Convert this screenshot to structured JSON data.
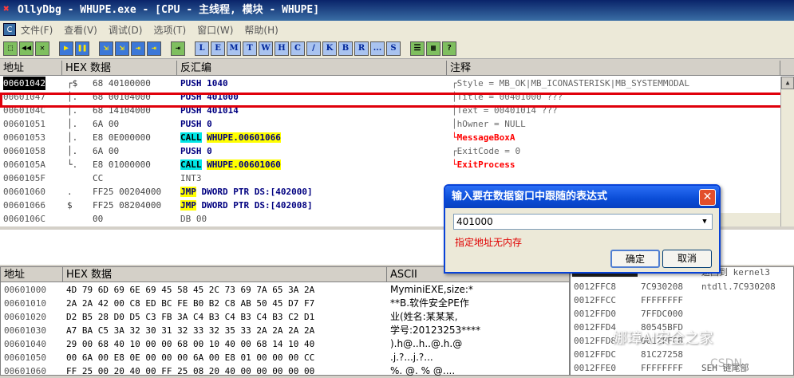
{
  "window": {
    "title": "OllyDbg - WHUPE.exe - [CPU - 主线程, 模块 - WHUPE]"
  },
  "menu": [
    "文件(F)",
    "查看(V)",
    "调试(D)",
    "选项(T)",
    "窗口(W)",
    "帮助(H)"
  ],
  "toolbar": {
    "buttons_left": [
      "⬚",
      "◀◀",
      "✕",
      "▶",
      "❚❚",
      "⇲",
      "⇲",
      "⇥",
      "⇥",
      "⇥"
    ],
    "letter_buttons": [
      "L",
      "E",
      "M",
      "T",
      "W",
      "H",
      "C",
      "/",
      "K",
      "B",
      "R",
      "...",
      "S"
    ],
    "buttons_right": [
      "☰",
      "▦",
      "?"
    ]
  },
  "cpu": {
    "headers": [
      "地址",
      "HEX 数据",
      "反汇编",
      "注释"
    ],
    "rows": [
      {
        "addr": "00601042",
        "brk": "┌$",
        "hex": "68 40100000",
        "dis": "PUSH 1040",
        "cmt": "┌Style = MB_OK|MB_ICONASTERISK|MB_SYSTEMMODAL"
      },
      {
        "addr": "00601047",
        "brk": "│.",
        "hex": "68 00104000",
        "dis": "PUSH 401000",
        "cmt": "│Title = 00401000 ???"
      },
      {
        "addr": "0060104C",
        "brk": "│.",
        "hex": "68 14104000",
        "dis": "PUSH 401014",
        "cmt": "│Text = 00401014 ???"
      },
      {
        "addr": "00601051",
        "brk": "│.",
        "hex": "6A 00",
        "dis": "PUSH 0",
        "cmt": "│hOwner = NULL"
      },
      {
        "addr": "00601053",
        "brk": "│.",
        "hex": "E8 0E000000",
        "dis_op": "CALL",
        "dis_arg": "WHUPE.00601066",
        "cmt": "└MessageBoxA"
      },
      {
        "addr": "00601058",
        "brk": "│.",
        "hex": "6A 00",
        "dis": "PUSH 0",
        "cmt": "┌ExitCode = 0"
      },
      {
        "addr": "0060105A",
        "brk": "└.",
        "hex": "E8 01000000",
        "dis_op": "CALL",
        "dis_arg": "WHUPE.00601060",
        "cmt": "└ExitProcess"
      },
      {
        "addr": "0060105F",
        "brk": "",
        "hex": "CC",
        "dis": "INT3",
        "cmt": ""
      },
      {
        "addr": "00601060",
        "brk": ".",
        "hex": "FF25 00204000",
        "dis_op": "JMP",
        "dis_arg": "DWORD PTR DS:[402000]",
        "cmt": ""
      },
      {
        "addr": "00601066",
        "brk": "$",
        "hex": "FF25 08204000",
        "dis_op": "JMP",
        "dis_arg": "DWORD PTR DS:[402008]",
        "cmt": ""
      },
      {
        "addr": "0060106C",
        "brk": "",
        "hex": "00",
        "dis": "DB 00",
        "cmt": ""
      }
    ]
  },
  "dump": {
    "headers": [
      "地址",
      "HEX 数据",
      "ASCII"
    ],
    "rows": [
      {
        "addr": "00601000",
        "hex": "4D 79 6D 69 6E 69 45 58 45 2C 73 69 7A 65 3A 2A",
        "ascii": "MyminiEXE,size:*"
      },
      {
        "addr": "00601010",
        "hex": "2A 2A 42 00 C8 ED BC FE B0 B2 C8 AB 50 45 D7 F7",
        "ascii": "**B.软件安全PE作"
      },
      {
        "addr": "00601020",
        "hex": "D2 B5 28 D0 D5 C3 FB 3A C4 B3 C4 B3 C4 B3 C2 D1",
        "ascii": "业(姓名:某某某,"
      },
      {
        "addr": "00601030",
        "hex": "A7 BA C5 3A 32 30 31 32 33 32 35 33 2A 2A 2A 2A",
        "ascii": "学号:20123253****"
      },
      {
        "addr": "00601040",
        "hex": "29 00 68 40 10 00 00 68 00 10 40 00 68 14 10 40",
        "ascii": ").h@..h..@.h.@"
      },
      {
        "addr": "00601050",
        "hex": "00 6A 00 E8 0E 00 00 00 6A 00 E8 01 00 00 00 CC",
        "ascii": ".j.?...j.?..."
      },
      {
        "addr": "00601060",
        "hex": "FF 25 00 20 40 00 FF 25 08 20 40 00 00 00 00 00",
        "ascii": "%. @.  %  @...."
      }
    ]
  },
  "stack": {
    "top_cmt": "返回到 kernel3",
    "rows": [
      {
        "addr": "0012FFC8",
        "val": "7C930208",
        "cmt": "ntdll.7C930208"
      },
      {
        "addr": "0012FFCC",
        "val": "FFFFFFFF",
        "cmt": ""
      },
      {
        "addr": "0012FFD0",
        "val": "7FFDC000",
        "cmt": ""
      },
      {
        "addr": "0012FFD4",
        "val": "80545BFD",
        "cmt": ""
      },
      {
        "addr": "0012FFD8",
        "val": "0012FFC8",
        "cmt": ""
      },
      {
        "addr": "0012FFDC",
        "val": "81C27258",
        "cmt": ""
      },
      {
        "addr": "0012FFE0",
        "val": "FFFFFFFF",
        "cmt": "SEH 链尾部"
      }
    ]
  },
  "dialog": {
    "title": "输入要在数据窗口中跟随的表达式",
    "input_value": "401000",
    "message": "指定地址无内存",
    "ok_label": "确定",
    "cancel_label": "取消"
  },
  "watermark": {
    "text": "娜璋AI安全之家",
    "sub": "CSDN"
  }
}
